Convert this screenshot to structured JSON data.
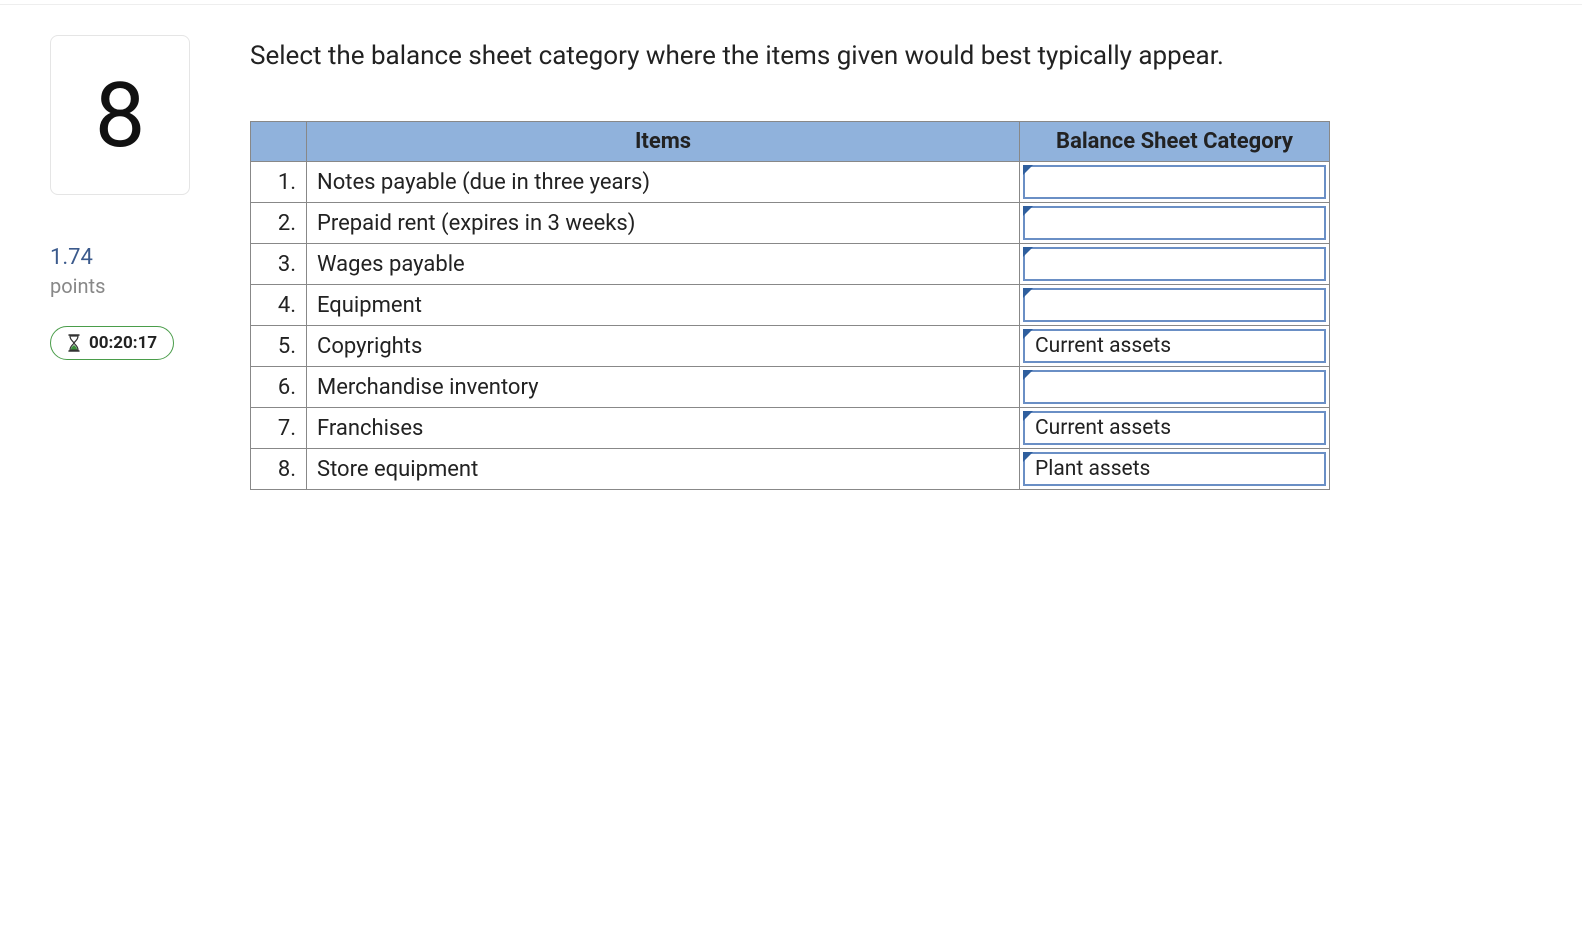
{
  "sidebar": {
    "question_number": "8",
    "points_value": "1.74",
    "points_label": "points",
    "timer": "00:20:17"
  },
  "question": {
    "prompt": "Select the balance sheet category where the items given would best typically appear."
  },
  "table": {
    "headers": {
      "items": "Items",
      "category": "Balance Sheet Category"
    },
    "rows": [
      {
        "n": "1.",
        "item": "Notes payable (due in three years)",
        "answer": ""
      },
      {
        "n": "2.",
        "item": "Prepaid rent (expires in 3 weeks)",
        "answer": ""
      },
      {
        "n": "3.",
        "item": "Wages payable",
        "answer": ""
      },
      {
        "n": "4.",
        "item": "Equipment",
        "answer": ""
      },
      {
        "n": "5.",
        "item": "Copyrights",
        "answer": "Current assets"
      },
      {
        "n": "6.",
        "item": "Merchandise inventory",
        "answer": ""
      },
      {
        "n": "7.",
        "item": "Franchises",
        "answer": "Current assets"
      },
      {
        "n": "8.",
        "item": "Store equipment",
        "answer": "Plant assets"
      }
    ]
  }
}
